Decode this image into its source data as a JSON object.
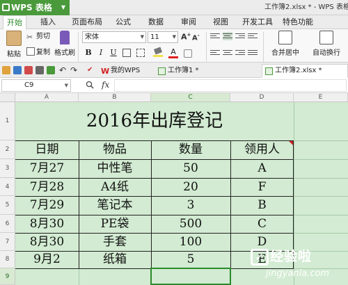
{
  "app": {
    "name": "WPS 表格"
  },
  "window": {
    "title": "工作簿2.xlsx * - WPS 表格"
  },
  "menu": {
    "tabs": [
      {
        "label": "开始",
        "active": true
      },
      {
        "label": "插入"
      },
      {
        "label": "页面布局"
      },
      {
        "label": "公式"
      },
      {
        "label": "数据"
      },
      {
        "label": "审阅"
      },
      {
        "label": "视图"
      },
      {
        "label": "开发工具"
      },
      {
        "label": "特色功能"
      }
    ]
  },
  "ribbon": {
    "paste": "粘贴",
    "cut": "剪切",
    "copy": "复制",
    "format_painter": "格式刷",
    "font_name": "宋体",
    "font_size": "11",
    "bold": "B",
    "italic": "I",
    "underline": "U",
    "merge_center": "合并居中",
    "wrap_text": "自动换行"
  },
  "doc_tabs": [
    {
      "label": "我的WPS"
    },
    {
      "label": "工作簿1 *"
    },
    {
      "label": "工作簿2.xlsx *",
      "active": true
    }
  ],
  "formula_bar": {
    "name_box": "C9",
    "fx": "fx",
    "content": ""
  },
  "grid": {
    "columns": [
      "A",
      "B",
      "C",
      "D",
      "E"
    ],
    "rows": [
      "1",
      "2",
      "3",
      "4",
      "5",
      "6",
      "7",
      "8",
      "9"
    ],
    "selected_cell": "C9",
    "title": "2016年出库登记",
    "headers": [
      "日期",
      "物品",
      "数量",
      "领用人"
    ],
    "data": [
      [
        "7月27",
        "中性笔",
        "50",
        "A"
      ],
      [
        "7月28",
        "A4纸",
        "20",
        "F"
      ],
      [
        "7月29",
        "笔记本",
        "3",
        "B"
      ],
      [
        "8月30",
        "PE袋",
        "500",
        "C"
      ],
      [
        "8月30",
        "手套",
        "100",
        "D"
      ],
      [
        "9月2",
        "纸箱",
        "5",
        "E"
      ]
    ]
  },
  "watermark": {
    "text": "经验啦",
    "check": "✓",
    "url": "jingyanla.com"
  },
  "colors": {
    "accent": "#4a9a3c",
    "sheet_bg": "#d2ebd2",
    "selection": "#2a8a2a"
  }
}
